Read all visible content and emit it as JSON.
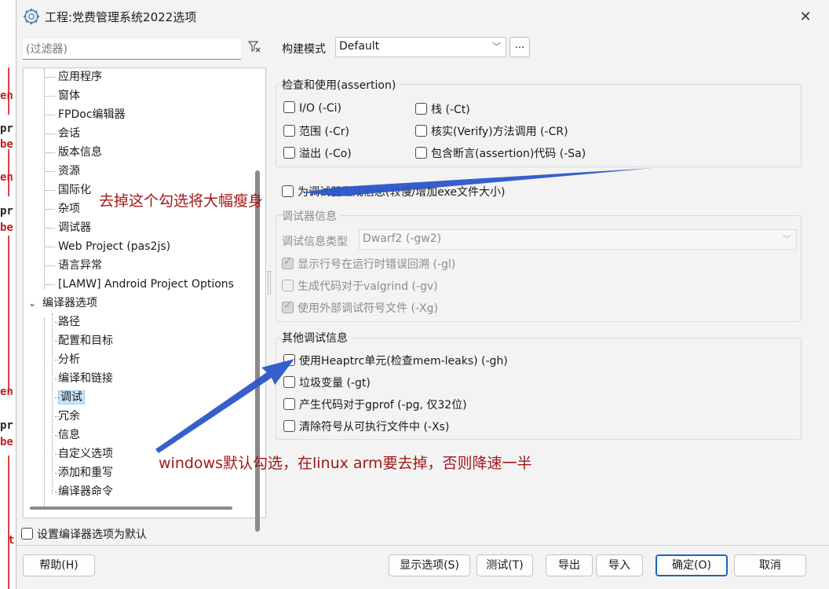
{
  "window": {
    "title": "工程:党费管理系统2022选项",
    "close_label": "✕"
  },
  "background_code": {
    "snippets": [
      {
        "text": "en",
        "cls": "r"
      },
      {
        "text": "pr",
        "cls": "k"
      },
      {
        "text": "be",
        "cls": "r"
      },
      {
        "text": "en",
        "cls": "r"
      },
      {
        "text": "pr",
        "cls": "k"
      },
      {
        "text": "be",
        "cls": "r"
      },
      {
        "text": "en",
        "cls": "r"
      },
      {
        "text": "pr",
        "cls": "k"
      },
      {
        "text": "be",
        "cls": "r"
      },
      {
        "text": "t",
        "cls": "r"
      }
    ]
  },
  "filter": {
    "placeholder": "(过滤器)"
  },
  "tree": {
    "items": [
      {
        "label": "应用程序"
      },
      {
        "label": "窗体"
      },
      {
        "label": "FPDoc编辑器"
      },
      {
        "label": "会话"
      },
      {
        "label": "版本信息"
      },
      {
        "label": "资源"
      },
      {
        "label": "国际化"
      },
      {
        "label": "杂项"
      },
      {
        "label": "调试器"
      },
      {
        "label": "Web Project (pas2js)"
      },
      {
        "label": "语言异常"
      },
      {
        "label": "[LAMW] Android Project Options"
      },
      {
        "label": "编译器选项",
        "parent": true
      },
      {
        "label": "路径"
      },
      {
        "label": "配置和目标"
      },
      {
        "label": "分析"
      },
      {
        "label": "编译和链接"
      },
      {
        "label": "调试",
        "selected": true
      },
      {
        "label": "冗余"
      },
      {
        "label": "信息"
      },
      {
        "label": "自定义选项"
      },
      {
        "label": "添加和重写"
      },
      {
        "label": "编译器命令"
      }
    ]
  },
  "set_default_label": "设置编译器选项为默认",
  "build_mode": {
    "label": "构建模式",
    "value": "Default",
    "more_label": "..."
  },
  "assertion_group": {
    "title": "检查和使用(assertion)",
    "options": [
      {
        "label": "I/O (-Ci)"
      },
      {
        "label": "栈 (-Ct)"
      },
      {
        "label": "范围 (-Cr)"
      },
      {
        "label": "核实(Verify)方法调用 (-CR)"
      },
      {
        "label": "溢出 (-Co)"
      },
      {
        "label": "包含断言(assertion)代码 (-Sa)"
      }
    ]
  },
  "debugger_generate_label": "为调试器生成信息(较慢/增加exe文件大小)",
  "debugger_info": {
    "title": "调试器信息",
    "type_label": "调试信息类型",
    "type_value": "Dwarf2 (-gw2)",
    "options": [
      {
        "label": "显示行号在运行时错误回溯 (-gl)",
        "state": "checked-disabled"
      },
      {
        "label": "生成代码对于valgrind (-gv)",
        "state": "disabled"
      },
      {
        "label": "使用外部调试符号文件 (-Xg)",
        "state": "checked-disabled"
      }
    ]
  },
  "other_debug": {
    "title": "其他调试信息",
    "options": [
      {
        "label": "使用Heaptrc单元(检查mem-leaks) (-gh)"
      },
      {
        "label": "垃圾变量 (-gt)"
      },
      {
        "label": "产生代码对于gprof (-pg, 仅32位)"
      },
      {
        "label": "清除符号从可执行文件中 (-Xs)"
      }
    ]
  },
  "annotations": {
    "note1": "去掉这个勾选将大幅瘦身",
    "note2": "windows默认勾选，在linux arm要去掉，否则降速一半",
    "arrow_color": "#2b55c9"
  },
  "buttons": {
    "help": "帮助(H)",
    "show_options": "显示选项(S)",
    "test": "测试(T)",
    "export": "导出",
    "import": "导入",
    "ok": "确定(O)",
    "cancel": "取消"
  }
}
